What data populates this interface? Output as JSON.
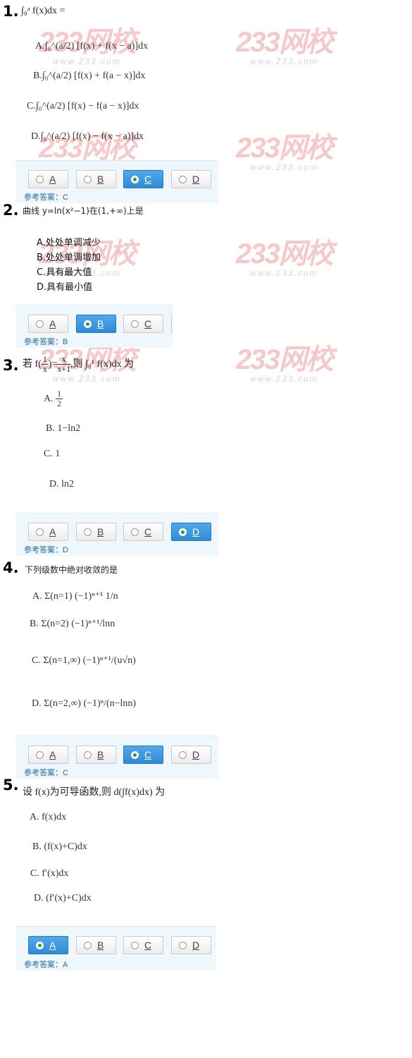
{
  "watermark": {
    "logo": "233网校",
    "url": "www.233.com",
    "color": "#f2b8b8"
  },
  "questions": [
    {
      "number": "1.",
      "stem": "∫₀ᵃ f(x)dx =",
      "options": [
        "A.∫₀^(a/2) [f(x) + f(x − a)]dx",
        "B.∫₀^(a/2) [f(x) + f(a − x)]dx",
        "C.∫₀^(a/2) [f(x) − f(a − x)]dx",
        "D.∫₀^(a/2) [f(x) − f(x − a)]dx"
      ],
      "choices": [
        "A",
        "B",
        "C",
        "D"
      ],
      "selected": "C",
      "answer_label": "参考答案：C"
    },
    {
      "number": "2.",
      "stem": "曲线 y=ln(x²−1)在(1,+∞)上是",
      "options": [
        "A.处处单调减少",
        "B.处处单调增加",
        "C.具有最大值",
        "D.具有最小值"
      ],
      "choices": [
        "A",
        "B",
        "C"
      ],
      "selected": "B",
      "answer_label": "参考答案：B"
    },
    {
      "number": "3.",
      "stem_pre": "若 f(",
      "stem_mid": ")=",
      "stem_post": ",则 ∫₀¹ f(x)dx 为",
      "stem_frac1": [
        "1",
        "x"
      ],
      "stem_frac2": [
        "x",
        "x+1"
      ],
      "options": [
        "A.",
        "B. 1−ln2",
        "C. 1",
        "D. ln2"
      ],
      "option_a_frac": [
        "1",
        "2"
      ],
      "choices": [
        "A",
        "B",
        "C",
        "D"
      ],
      "selected": "D",
      "answer_label": "参考答案：D"
    },
    {
      "number": "4.",
      "stem": "下列级数中绝对收敛的是",
      "options": [
        "A. Σ(n=1) (−1)ⁿ⁺¹ 1/n",
        "B. Σ(n=2) (−1)ⁿ⁺¹/lnn",
        "C. Σ(n=1,∞) (−1)ⁿ⁺¹/(u√n)",
        "D. Σ(n=2,∞) (−1)ⁿ/(n−lnn)"
      ],
      "choices": [
        "A",
        "B",
        "C",
        "D"
      ],
      "selected": "C",
      "answer_label": "参考答案：C"
    },
    {
      "number": "5.",
      "stem": "设 f(x)为可导函数,则 d(∫f(x)dx) 为",
      "options": [
        "A. f(x)dx",
        "B. (f(x)+C)dx",
        "C. f′(x)dx",
        "D. (f′(x)+C)dx"
      ],
      "choices": [
        "A",
        "B",
        "C",
        "D"
      ],
      "selected": "A",
      "answer_label": "参考答案：A"
    }
  ],
  "colors": {
    "selected_button": "#3a96dc",
    "answer_text": "#2a6a9a",
    "answer_box": "#eef7fc"
  }
}
